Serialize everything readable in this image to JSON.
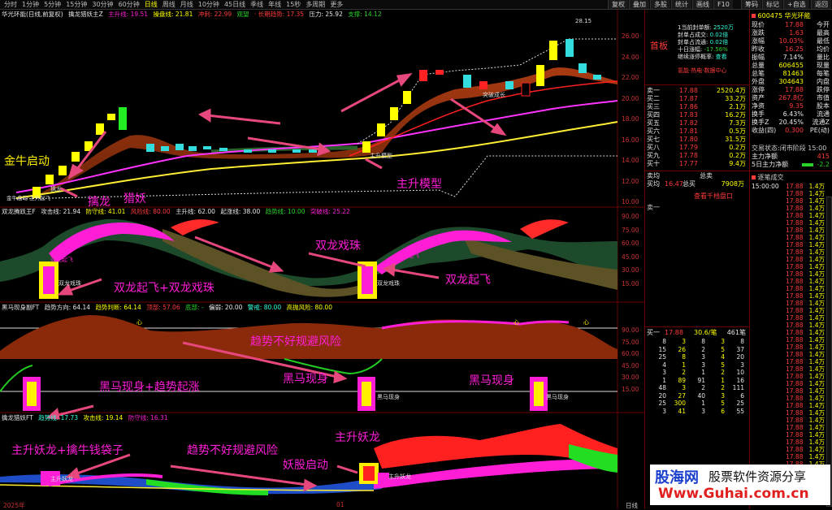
{
  "topbar": {
    "timeframes": [
      "分时",
      "1分钟",
      "5分钟",
      "15分钟",
      "30分钟",
      "60分钟",
      "日线",
      "周线",
      "月线",
      "10分钟",
      "45日线",
      "季线",
      "年线",
      "15秒",
      "多周期",
      "更多"
    ],
    "active": "日线",
    "right_buttons": [
      "复权",
      "叠加",
      "多股",
      "统计",
      "画线",
      "F10",
      "筹码",
      "标记",
      "+自选",
      "返回"
    ]
  },
  "panel1": {
    "title": [
      "华光环能(日线,前复权)",
      "擒龙猎妖主Z",
      "主升线: 19.51",
      "操盘线: 21.81",
      "冲刺: 22.99",
      "观望",
      "· 长期趋势: 17.35",
      "压力: 25.92",
      "支撑: 14.12"
    ],
    "yaxis": [
      "26.00",
      "24.00",
      "22.00",
      "20.00",
      "18.00",
      "16.00",
      "14.00",
      "12.00",
      "10.00"
    ],
    "high_label": "28.15",
    "annotations": {
      "jinniu": "金牛启动",
      "qinlong": "擒龙",
      "lieyao": "猎妖",
      "zhushengmoxing": "主升模型",
      "small_zhusheng": "主升模型",
      "small_tupo": "突破成长",
      "small_qinlong": "擒龙",
      "small_jinniu": "金牛启动·主升起飞"
    }
  },
  "panel2": {
    "title": [
      "双龙腾跃王F",
      "攻击线: 21.94",
      "防守线: 41.01",
      "风险线: 80.00",
      "主升线: 62.00",
      "起涨线: 38.00",
      "趋势线: 10.00",
      "突破线: 25.22"
    ],
    "yaxis": [
      "90.00",
      "75.00",
      "60.00",
      "45.00",
      "30.00",
      "15.00"
    ],
    "annotations": {
      "shuanglong_xizhu": "双龙戏珠",
      "qifei_xizhu": "双龙起飞+双龙戏珠",
      "qifei": "双龙起飞",
      "small_a": "双龙起飞",
      "small_b": "双龙戏珠",
      "small_c": "双龙起飞",
      "small_d": "双龙戏珠"
    }
  },
  "panel3": {
    "title": [
      "黑马现身副FT",
      "趋势方向: 64.14",
      "趋势判断: 64.14",
      "顶部: 57.06",
      "底部: -",
      "偏弱: 20.00",
      "警戒: 80.00",
      "高抛风险: 80.00"
    ],
    "yaxis": [
      "90.00",
      "75.00",
      "60.00",
      "45.00",
      "30.00",
      "15.00"
    ],
    "annotations": {
      "qushi_fengxian": "趋势不好规避风险",
      "heima_qizhang": "黑马现身+趋势起涨",
      "heima1": "黑马现身",
      "heima2": "黑马现身",
      "xin": "心",
      "small_heima": "黑马现身"
    }
  },
  "panel4": {
    "title": [
      "擒龙猎妖FT",
      "趋势线: 17.73",
      "攻击线: 19.14",
      "防守线: 16.31"
    ],
    "annotations": {
      "zhusheng_yaolong": "主升妖龙",
      "zhusheng_yaolong_qianniu": "主升妖龙+擒牛钱袋子",
      "qushi_fengxian": "趋势不好规避风险",
      "yaogu_qidong": "妖股启动",
      "small_a": "主升妖龙",
      "small_b": "主升妖龙"
    }
  },
  "bottom_axis": {
    "left": "2025年",
    "mid": "01",
    "right": "日线"
  },
  "news_panel": {
    "title": "首板",
    "lines": [
      {
        "k": "1当前封单额",
        "v": "2520万"
      },
      {
        "k": "封单占成交",
        "v": "0.02倍"
      },
      {
        "k": "封单占流通",
        "v": "0.02倍"
      },
      {
        "k": "十日涨幅",
        "v": "-17.56%"
      },
      {
        "k": "继续涨停概率",
        "v": "查看"
      }
    ],
    "tags": "氢能·热电·数据中心"
  },
  "orderbook": {
    "sell": [
      {
        "label": "卖一",
        "price": "17.88",
        "vol": "2520.4万"
      },
      {
        "label": "买二",
        "price": "17.87",
        "vol": "33.2万"
      },
      {
        "label": "买三",
        "price": "17.86",
        "vol": "2.1万"
      },
      {
        "label": "买四",
        "price": "17.83",
        "vol": "16.2万"
      },
      {
        "label": "买五",
        "price": "17.82",
        "vol": "7.3万"
      },
      {
        "label": "买六",
        "price": "17.81",
        "vol": "0.5万"
      },
      {
        "label": "买七",
        "price": "17.80",
        "vol": "31.5万"
      },
      {
        "label": "买八",
        "price": "17.79",
        "vol": "0.2万"
      },
      {
        "label": "买九",
        "price": "17.78",
        "vol": "0.2万"
      },
      {
        "label": "买十",
        "price": "17.77",
        "vol": "9.4万"
      }
    ],
    "avg_label": "卖均",
    "avg_label2": "买均",
    "avg_val": "16.47",
    "total_label": "总卖",
    "total_label2": "总买",
    "total_val": "7908万",
    "link": "查看千档盘口"
  },
  "trade_summary": {
    "label": "买一",
    "price": "17.88",
    "num": "30.6/笔",
    "count": "461笔",
    "grid": [
      [
        "8",
        "3",
        "8",
        "3",
        "8"
      ],
      [
        "15",
        "26",
        "2",
        "5",
        "37"
      ],
      [
        "25",
        "8",
        "3",
        "4",
        "20"
      ],
      [
        "4",
        "1",
        "3",
        "5",
        "3"
      ],
      [
        "3",
        "2",
        "1",
        "2",
        "10"
      ],
      [
        "1",
        "89",
        "91",
        "1",
        "16"
      ],
      [
        "48",
        "3",
        "2",
        "2",
        "111"
      ],
      [
        "20",
        "27",
        "40",
        "3",
        "6"
      ],
      [
        "25",
        "300",
        "1",
        "5",
        "25"
      ],
      [
        "3",
        "41",
        "3",
        "6",
        "55"
      ]
    ]
  },
  "quote": {
    "code": "600475",
    "name": "华光环能",
    "rows": [
      {
        "k": "现价",
        "v": "17.88",
        "k2": "今开",
        "v2": ""
      },
      {
        "k": "涨跌",
        "v": "1.63",
        "k2": "最高",
        "v2": ""
      },
      {
        "k": "涨幅",
        "v": "10.03%",
        "k2": "最低",
        "v2": ""
      },
      {
        "k": "昨收",
        "v": "16.25",
        "k2": "均价",
        "v2": ""
      },
      {
        "k": "振幅",
        "v": "7.14%",
        "k2": "量比",
        "v2": ""
      },
      {
        "k": "总量",
        "v": "606455",
        "k2": "现量",
        "v2": ""
      },
      {
        "k": "总笔",
        "v": "81463",
        "k2": "每笔",
        "v2": ""
      },
      {
        "k": "外盘",
        "v": "304643",
        "k2": "内盘",
        "v2": ""
      },
      {
        "k": "涨停",
        "v": "17.88",
        "k2": "跌停",
        "v2": ""
      },
      {
        "k": "资产",
        "v": "267.8亿",
        "k2": "市值",
        "v2": ""
      },
      {
        "k": "净资",
        "v": "9.35",
        "k2": "股本",
        "v2": ""
      },
      {
        "k": "换手",
        "v": "6.43%",
        "k2": "流通",
        "v2": ""
      },
      {
        "k": "换手Z",
        "v": "20.45%",
        "k2": "流通Z",
        "v2": ""
      },
      {
        "k": "收益(四)",
        "v": "0.300",
        "k2": "PE(动)",
        "v2": ""
      }
    ],
    "status": "交易状态:闭市阶段 15:00",
    "zhuli1": "主力净额",
    "zhuli1_v": "415",
    "zhuli2": "5日主力净额",
    "zhuli2_v": "-2.2"
  },
  "ticks": {
    "title": "逐笔成交",
    "first": {
      "time": "15:00:00",
      "price": "17.88",
      "vol": "1.4万"
    },
    "price": "17.88",
    "vols": [
      "1.4万",
      "1.4万",
      "1.4万",
      "1.4万",
      "1.4万",
      "1.4万",
      "1.4万",
      "1.4万",
      "1.4万",
      "1.4万",
      "1.4万",
      "1.4万",
      "1.4万",
      "1.4万",
      "1.4万",
      "1.4万",
      "1.4万",
      "1.4万",
      "1.4万",
      "1.4万",
      "1.4万",
      "1.4万",
      "1.4万",
      "1.4万",
      "1.4万",
      "1.4万",
      "1.4万",
      "1.4万",
      "1.4万",
      "1.4万",
      "1.4万",
      "1.4万",
      "1.4万",
      "1.4万",
      "1.4万",
      "1.4万",
      "1.4万",
      "1.4万",
      "1.4万",
      "1.4万"
    ]
  },
  "watermark": {
    "brand": "股海网",
    "slogan": "股票软件资源分享",
    "url": "Www.Guhai.com.cn"
  }
}
